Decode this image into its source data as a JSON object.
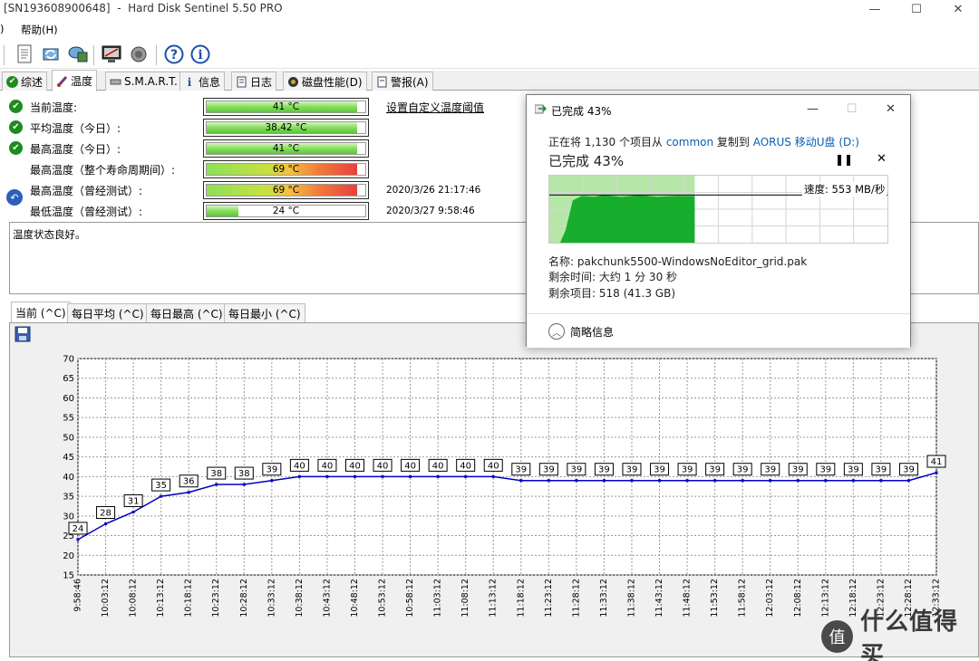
{
  "window": {
    "title": "[SN193608900648]  -  Hard Disk Sentinel 5.50 PRO",
    "controls": [
      "—",
      "☐",
      "✕"
    ]
  },
  "menu": {
    "left_fragment": ")",
    "help": "帮助(H)"
  },
  "toolbar": {
    "buttons": [
      "report-icon",
      "refresh-icon",
      "disk-icon",
      "monitor-icon",
      "sound-icon",
      "help-icon",
      "info-icon"
    ]
  },
  "tabs": [
    {
      "label": "综述",
      "icon": "check-icon"
    },
    {
      "label": "温度",
      "icon": "thermometer-icon"
    },
    {
      "label": "S.M.A.R.T.",
      "icon": "drive-icon"
    },
    {
      "label": "信息",
      "icon": "info-icon"
    },
    {
      "label": "日志",
      "icon": "log-icon"
    },
    {
      "label": "磁盘性能(D)",
      "icon": "performance-icon"
    },
    {
      "label": "警报(A)",
      "icon": "alert-icon"
    }
  ],
  "temps": [
    {
      "label": "当前温度:",
      "value": "41 °C",
      "fraction": 0.95,
      "status": "ok",
      "date": ""
    },
    {
      "label": "平均温度（今日）:",
      "value": "38.42 °C",
      "fraction": 0.95,
      "status": "ok",
      "date": ""
    },
    {
      "label": "最高温度（今日）:",
      "value": "41 °C",
      "fraction": 0.95,
      "status": "ok",
      "date": ""
    },
    {
      "label": "最高温度（整个寿命周期间）:",
      "value": "69 °C",
      "fraction": 0.95,
      "status": "hot",
      "date": ""
    },
    {
      "label": "最高温度（曾经测试）:",
      "value": "69 °C",
      "fraction": 0.95,
      "status": "hot",
      "date": "2020/3/26 21:17:46"
    },
    {
      "label": "最低温度（曾经测试）:",
      "value": "24 °C",
      "fraction": 0.2,
      "status": "ok",
      "date": "2020/3/27 9:58:46"
    }
  ],
  "temp_link": "设置自定义温度阈值",
  "status_text": "温度状态良好。",
  "chart_tabs": [
    "当前 (^C)",
    "每日平均 (^C)",
    "每日最高 (^C)",
    "每日最小 (^C)"
  ],
  "chart_data": {
    "type": "line",
    "title": "",
    "xlabel": "",
    "ylabel": "",
    "ylim": [
      15,
      70
    ],
    "yticks": [
      15,
      20,
      25,
      30,
      35,
      40,
      45,
      50,
      55,
      60,
      65,
      70
    ],
    "grid": true,
    "x": [
      "9:58:46",
      "10:03:12",
      "10:08:12",
      "10:13:12",
      "10:18:12",
      "10:23:12",
      "10:28:12",
      "10:33:12",
      "10:38:12",
      "10:43:12",
      "10:48:12",
      "10:53:12",
      "10:58:12",
      "11:03:12",
      "11:08:12",
      "11:13:12",
      "11:18:12",
      "11:23:12",
      "11:28:12",
      "11:33:12",
      "11:38:12",
      "11:43:12",
      "11:48:12",
      "11:53:12",
      "11:58:12",
      "12:03:12",
      "12:08:12",
      "12:13:12",
      "12:18:12",
      "12:23:12",
      "12:28:12",
      "12:33:12"
    ],
    "series": [
      {
        "values": [
          24,
          28,
          31,
          35,
          36,
          38,
          38,
          39,
          40,
          40,
          40,
          40,
          40,
          40,
          40,
          40,
          39,
          39,
          39,
          39,
          39,
          39,
          39,
          39,
          39,
          39,
          39,
          39,
          39,
          39,
          39,
          41
        ],
        "color": "#0000c8"
      }
    ]
  },
  "copy_dialog": {
    "title": "已完成 43%",
    "line_parts": [
      "正在将 1,130 个项目从 ",
      "common",
      " 复制到 ",
      "AORUS 移动U盘 (D:)"
    ],
    "progress_text": "已完成 43%",
    "progress": 0.43,
    "speed": "速度: 553 MB/秒",
    "name": "名称:  pakchunk5500-WindowsNoEditor_grid.pak",
    "time_left": "剩余时间:  大约 1 分 30 秒",
    "items_left": "剩余项目:  518 (41.3 GB)",
    "less_info": "简略信息",
    "pause_icon": "pause-icon",
    "cancel_icon": "close-icon"
  },
  "watermark": {
    "logo_char": "值",
    "text": "什么值得买"
  },
  "colors": {
    "ok": "#1c8c1c",
    "line": "#0000c8",
    "graph_fill": "#17ad2d",
    "graph_done_bg": "#b6e6a8",
    "link": "#0a5fb0"
  }
}
